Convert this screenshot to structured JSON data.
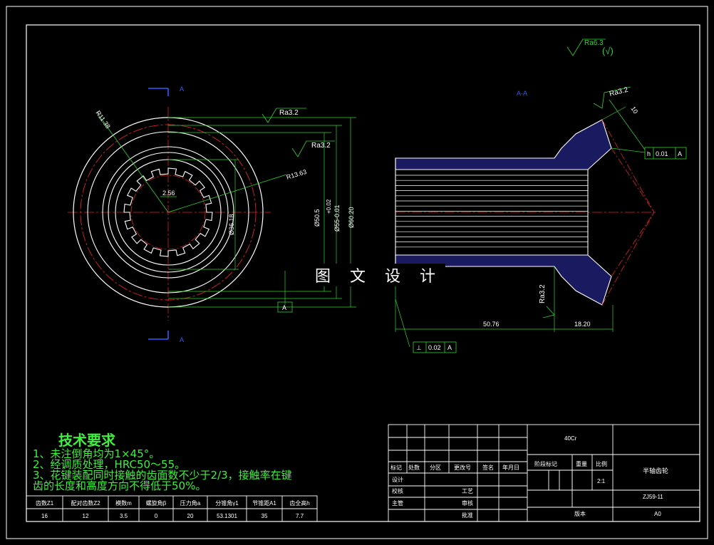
{
  "views": {
    "section_marker": "A",
    "section_title": "A-A"
  },
  "roughness": {
    "global": "Ra6.3",
    "global_note": "(√)",
    "r1": "Ra3.2",
    "r2": "Ra3.2",
    "r3": "Ra3.2",
    "r4": "Ra3.2"
  },
  "dimensions": {
    "d_outer": "Ø60.20",
    "d_mid": "Ø55-0.01",
    "d_mid_tol": "+0.02",
    "d_bore": "Ø50.5",
    "d_spline": "Ø36.18",
    "r_a": "R13.63",
    "r_b": "R11.38",
    "w_key": "2.56",
    "len_main": "50.76",
    "len_cone": "18.20",
    "chamfer": "10"
  },
  "tolerances": {
    "runout_sym": "h",
    "runout_val": "0.01",
    "runout_ref": "A",
    "perp_sym": "⊥",
    "perp_val": "0.02",
    "perp_ref": "A",
    "datum": "A"
  },
  "tech": {
    "title": "技术要求",
    "line1": "1、未注倒角均为1×45°。",
    "line2": "2、经调质处理，HRC50～55。",
    "line3": "3、花键装配同时接触的齿面数不少于2/3，接触率在键",
    "line4": "   齿的长度和高度方向不得低于50%。"
  },
  "params": {
    "headers": [
      "齿数Z1",
      "配对齿数Z2",
      "模数m",
      "螺旋角β",
      "压力角a",
      "分锥角γ1",
      "节锥距A1",
      "齿全高h"
    ],
    "values": [
      "16",
      "12",
      "3.5",
      "0",
      "20",
      "53.1301",
      "35",
      "7.7"
    ]
  },
  "title_block": {
    "material": "40Cr",
    "part_name": "半轴齿轮",
    "drawing_no": "ZJ59-11",
    "scale_label": "比例",
    "scale": "2:1",
    "weight_label": "重量",
    "stage_label": "阶段标记",
    "version_label": "版本",
    "sheet": "A0",
    "rev_labels": [
      "标记",
      "处数",
      "分区",
      "更改号",
      "签名",
      "年月日"
    ],
    "design": "设计",
    "check": "校核",
    "chief": "主管",
    "process": "工艺",
    "review": "审核",
    "approve": "批准"
  },
  "watermark": "图 文 设 计",
  "colors": {
    "outline": "#ffffff",
    "dimension": "#2fd52f",
    "center": "#e02020",
    "hatch": "#4040ff",
    "marker": "#2a5cff"
  }
}
